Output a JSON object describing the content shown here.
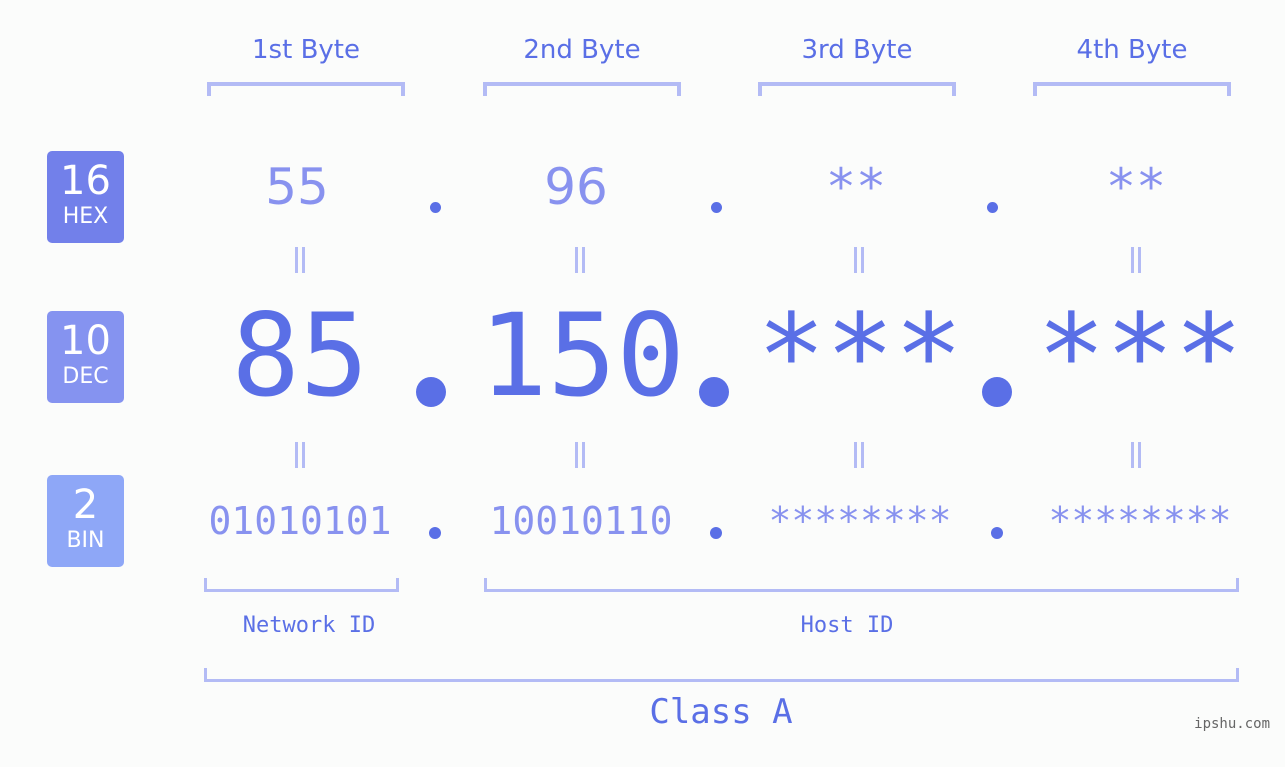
{
  "colors": {
    "hex_badge": "#7280ea",
    "dec_badge": "#8593f0",
    "bin_badge": "#8ea7f7",
    "accent": "#5a6fe6",
    "light_value": "#8892ef",
    "bracket": "#b3bbf5",
    "background": "#fbfcfb"
  },
  "bases": [
    {
      "number": "16",
      "label": "HEX"
    },
    {
      "number": "10",
      "label": "DEC"
    },
    {
      "number": "2",
      "label": "BIN"
    }
  ],
  "byte_headers": [
    "1st Byte",
    "2nd Byte",
    "3rd Byte",
    "4th Byte"
  ],
  "hex_values": [
    "55",
    "96",
    "**",
    "**"
  ],
  "dec_values": [
    "85",
    "150",
    "***",
    "***"
  ],
  "bin_values": [
    "01010101",
    "10010110",
    "********",
    "********"
  ],
  "separator": ".",
  "network_id_label": "Network ID",
  "host_id_label": "Host ID",
  "class_label": "Class A",
  "watermark": "ipshu.com"
}
